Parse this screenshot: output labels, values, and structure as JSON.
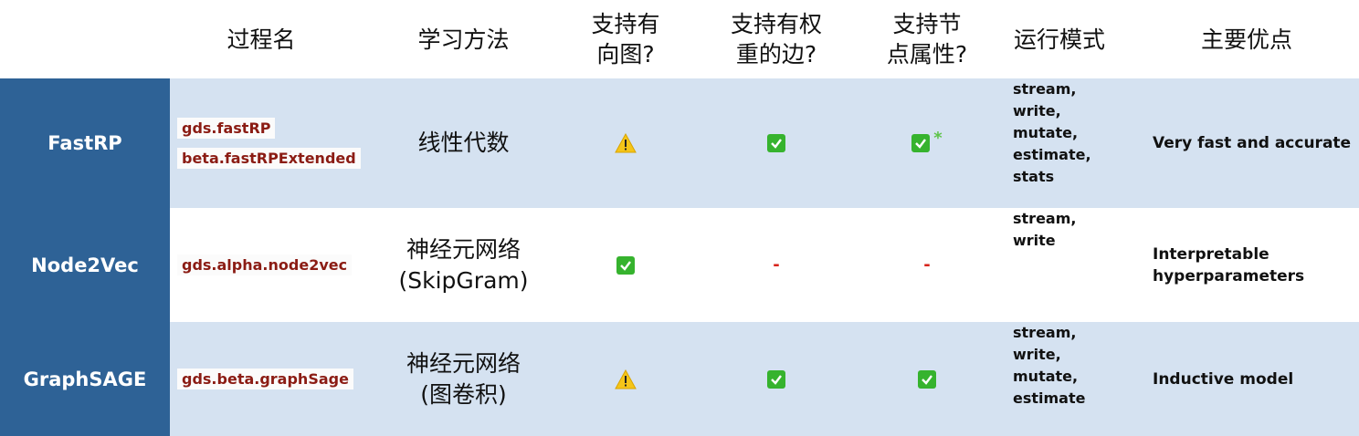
{
  "headers": {
    "procedure": "过程名",
    "learning_method": "学习方法",
    "directed": [
      "支持有",
      "向图?"
    ],
    "weighted": [
      "支持有权",
      "重的边?"
    ],
    "node_props": [
      "支持节",
      "点属性?"
    ],
    "run_modes": "运行模式",
    "advantages": "主要优点"
  },
  "rows": [
    {
      "name": "FastRP",
      "procedures": [
        "gds.fastRP",
        "beta.fastRPExtended"
      ],
      "method": [
        "线性代数"
      ],
      "directed": "warning-icon",
      "weighted": "check-icon",
      "node_props": "check-icon",
      "node_props_note": "*",
      "modes": [
        "stream,",
        "write,",
        "mutate,",
        "estimate,",
        "stats"
      ],
      "advantage": "Very fast and accurate"
    },
    {
      "name": "Node2Vec",
      "procedures": [
        "gds.alpha.node2vec"
      ],
      "method": [
        "神经元网络",
        "(SkipGram)"
      ],
      "directed": "check-icon",
      "weighted_text": "-",
      "node_props_text": "-",
      "modes": [
        "stream,",
        "write"
      ],
      "advantage": [
        "Interpretable",
        "hyperparameters"
      ]
    },
    {
      "name": "GraphSAGE",
      "procedures": [
        "gds.beta.graphSage"
      ],
      "method": [
        "神经元网络",
        "(图卷积)"
      ],
      "directed": "warning-icon",
      "weighted": "check-icon",
      "node_props": "check-icon",
      "modes": [
        "stream,",
        "write,",
        "mutate,",
        "estimate"
      ],
      "advantage": "Inductive model"
    }
  ],
  "colors": {
    "label_bg": "#2e6296",
    "band_bg": "#d5e2f1",
    "code_text": "#8b1c14",
    "check_green": "#36b32e",
    "warning_yellow": "#f5c518",
    "dash_red": "#d7241b"
  }
}
